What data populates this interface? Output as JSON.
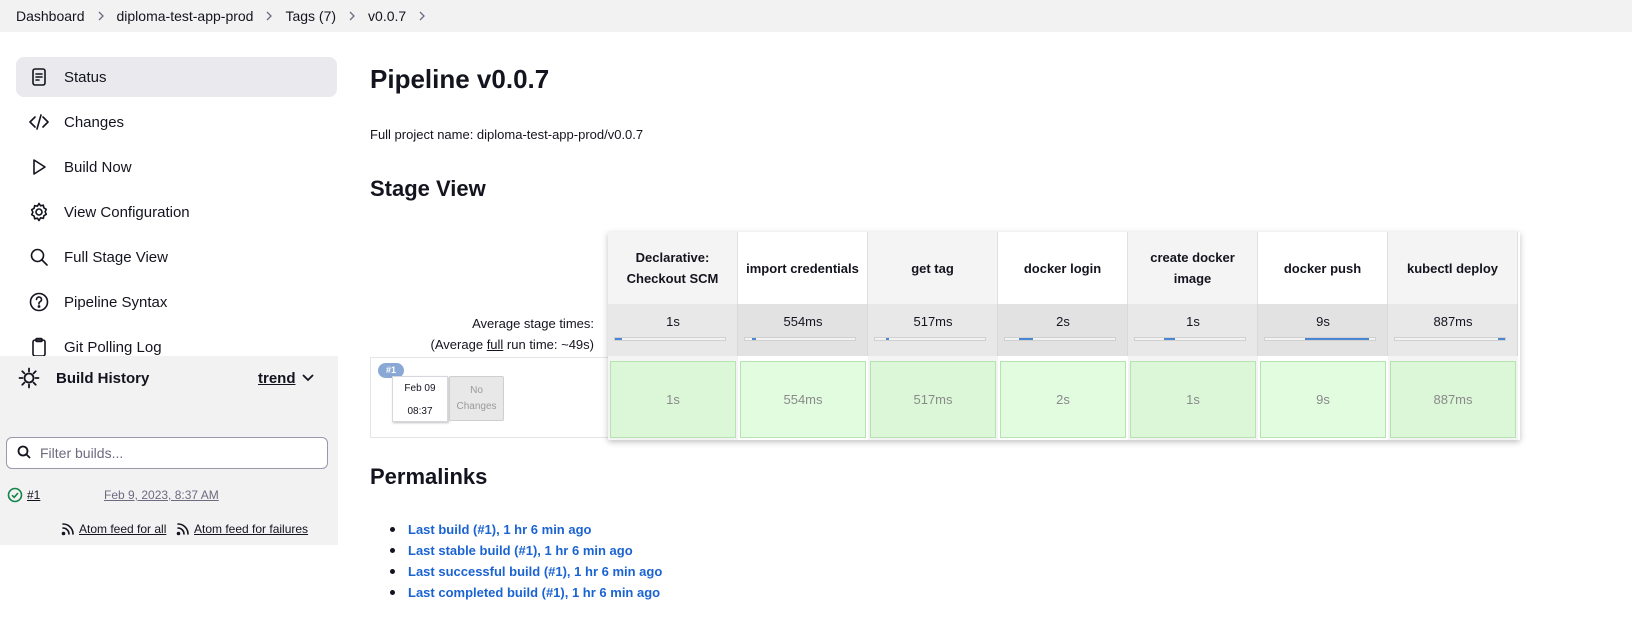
{
  "breadcrumb": {
    "items": [
      "Dashboard",
      "diploma-test-app-prod",
      "Tags (7)",
      "v0.0.7"
    ]
  },
  "sidebar": {
    "tasks": [
      {
        "label": "Status",
        "icon": "status-icon",
        "active": true
      },
      {
        "label": "Changes",
        "icon": "code-icon"
      },
      {
        "label": "Build Now",
        "icon": "play-icon"
      },
      {
        "label": "View Configuration",
        "icon": "gear-icon"
      },
      {
        "label": "Full Stage View",
        "icon": "search-icon"
      },
      {
        "label": "Pipeline Syntax",
        "icon": "help-icon"
      },
      {
        "label": "Git Polling Log",
        "icon": "clipboard-icon"
      }
    ],
    "build_history": {
      "title": "Build History",
      "trend_label": "trend",
      "filter_placeholder": "Filter builds...",
      "builds": [
        {
          "number": "#1",
          "date": "Feb 9, 2023, 8:37 AM",
          "status": "success"
        }
      ],
      "feed_all": "Atom feed for all",
      "feed_failures": "Atom feed for failures"
    }
  },
  "main": {
    "title": "Pipeline v0.0.7",
    "full_project_name": "Full project name: diploma-test-app-prod/v0.0.7",
    "stage_view": {
      "heading": "Stage View",
      "avg_label": "Average stage times:",
      "avg_full_prefix": "(Average ",
      "avg_full_word": "full",
      "avg_full_suffix": " run time: ~49s)",
      "stages": [
        {
          "name": "Declarative: Checkout SCM",
          "avg": "1s",
          "run": "1s",
          "progress_start": 0.0,
          "progress_width": 0.06
        },
        {
          "name": "import credentials",
          "avg": "554ms",
          "run": "554ms",
          "progress_start": 0.06,
          "progress_width": 0.04
        },
        {
          "name": "get tag",
          "avg": "517ms",
          "run": "517ms",
          "progress_start": 0.1,
          "progress_width": 0.03
        },
        {
          "name": "docker login",
          "avg": "2s",
          "run": "2s",
          "progress_start": 0.13,
          "progress_width": 0.13
        },
        {
          "name": "create docker image",
          "avg": "1s",
          "run": "1s",
          "progress_start": 0.26,
          "progress_width": 0.1
        },
        {
          "name": "docker push",
          "avg": "9s",
          "run": "9s",
          "progress_start": 0.36,
          "progress_width": 0.58
        },
        {
          "name": "kubectl deploy",
          "avg": "887ms",
          "run": "887ms",
          "progress_start": 0.94,
          "progress_width": 0.06
        }
      ],
      "run": {
        "badge": "#1",
        "date": "Feb 09",
        "time": "08:37",
        "changes": "No Changes"
      }
    },
    "permalinks": {
      "heading": "Permalinks",
      "items": [
        "Last build (#1), 1 hr 6 min ago",
        "Last stable build (#1), 1 hr 6 min ago",
        "Last successful build (#1), 1 hr 6 min ago",
        "Last completed build (#1), 1 hr 6 min ago"
      ]
    }
  },
  "colors": {
    "link": "#1a63d2",
    "success_cell": "#e2fce0",
    "success_icon": "#138347",
    "progress": "#4a86d4"
  }
}
